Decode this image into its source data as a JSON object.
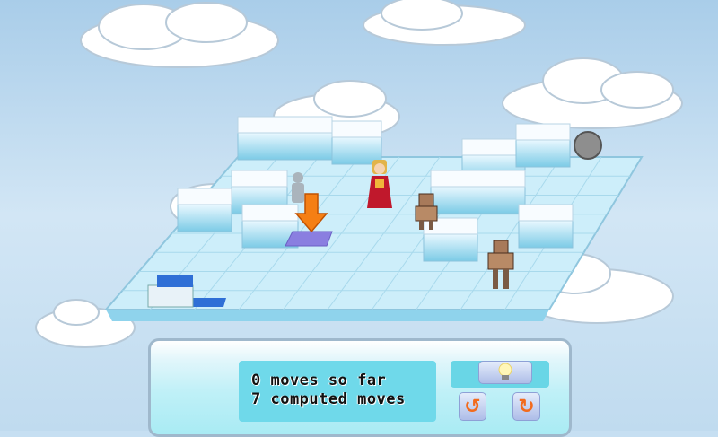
{
  "game": {
    "status": {
      "moves_so_far": "0 moves so far",
      "computed_moves": "7 computed moves"
    },
    "buttons": {
      "hint_icon": "lightbulb-icon",
      "undo_icon": "undo-arrow-icon",
      "redo_icon": "redo-arrow-icon"
    },
    "colors": {
      "sky": "#c6dff2",
      "ice": "#cfeefb",
      "accent_orange": "#f26b1d",
      "target_tile": "#8a7ee0"
    }
  }
}
